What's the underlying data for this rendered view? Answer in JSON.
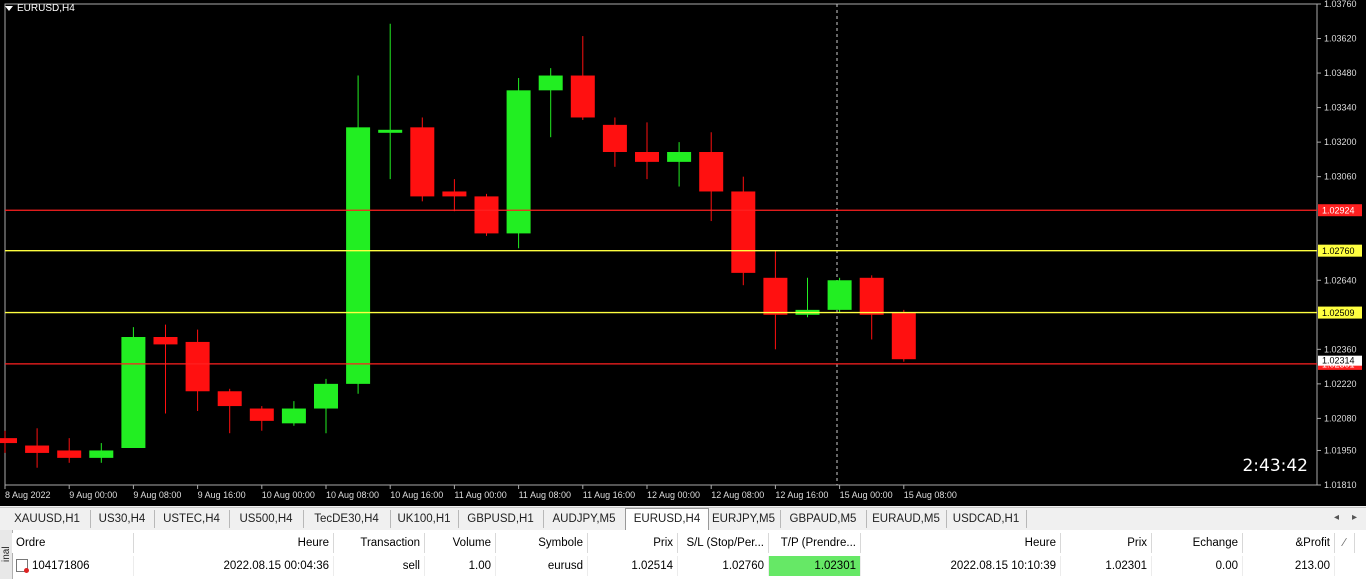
{
  "chart": {
    "title": "EURUSD,H4",
    "timer": "2:43:42"
  },
  "chart_data": {
    "type": "candlestick",
    "symbol": "EURUSD",
    "timeframe": "H4",
    "ylim": [
      1.0181,
      1.0376
    ],
    "price_ticks": [
      "1.03760",
      "1.03620",
      "1.03480",
      "1.03340",
      "1.03200",
      "1.03060",
      "1.02640",
      "1.02360",
      "1.02220",
      "1.02080",
      "1.01950",
      "1.01810"
    ],
    "time_labels": [
      "8 Aug 2022",
      "9 Aug 00:00",
      "9 Aug 08:00",
      "9 Aug 16:00",
      "10 Aug 00:00",
      "10 Aug 08:00",
      "10 Aug 16:00",
      "11 Aug 00:00",
      "11 Aug 08:00",
      "11 Aug 16:00",
      "12 Aug 00:00",
      "12 Aug 08:00",
      "12 Aug 16:00",
      "15 Aug 00:00",
      "15 Aug 08:00"
    ],
    "candles": [
      {
        "o": 1.02,
        "h": 1.0203,
        "l": 1.0194,
        "c": 1.0198
      },
      {
        "o": 1.0197,
        "h": 1.0204,
        "l": 1.0188,
        "c": 1.0194
      },
      {
        "o": 1.0195,
        "h": 1.02,
        "l": 1.019,
        "c": 1.0192
      },
      {
        "o": 1.0192,
        "h": 1.0198,
        "l": 1.019,
        "c": 1.0195
      },
      {
        "o": 1.0196,
        "h": 1.0245,
        "l": 1.0196,
        "c": 1.0241
      },
      {
        "o": 1.0241,
        "h": 1.0246,
        "l": 1.021,
        "c": 1.0238
      },
      {
        "o": 1.0239,
        "h": 1.0244,
        "l": 1.0211,
        "c": 1.0219
      },
      {
        "o": 1.0219,
        "h": 1.022,
        "l": 1.0202,
        "c": 1.0213
      },
      {
        "o": 1.0212,
        "h": 1.0213,
        "l": 1.0203,
        "c": 1.0207
      },
      {
        "o": 1.0206,
        "h": 1.0215,
        "l": 1.0205,
        "c": 1.0212
      },
      {
        "o": 1.0212,
        "h": 1.0224,
        "l": 1.0202,
        "c": 1.0222
      },
      {
        "o": 1.0222,
        "h": 1.0347,
        "l": 1.0218,
        "c": 1.0326
      },
      {
        "o": 1.0325,
        "h": 1.0368,
        "l": 1.0305,
        "c": 1.0325
      },
      {
        "o": 1.0326,
        "h": 1.033,
        "l": 1.0296,
        "c": 1.0298
      },
      {
        "o": 1.03,
        "h": 1.0305,
        "l": 1.0292,
        "c": 1.0298
      },
      {
        "o": 1.0298,
        "h": 1.0299,
        "l": 1.0282,
        "c": 1.0283
      },
      {
        "o": 1.0283,
        "h": 1.0346,
        "l": 1.0277,
        "c": 1.0341
      },
      {
        "o": 1.0341,
        "h": 1.035,
        "l": 1.0322,
        "c": 1.0347
      },
      {
        "o": 1.0347,
        "h": 1.0363,
        "l": 1.0329,
        "c": 1.033
      },
      {
        "o": 1.0327,
        "h": 1.033,
        "l": 1.031,
        "c": 1.0316
      },
      {
        "o": 1.0316,
        "h": 1.0328,
        "l": 1.0305,
        "c": 1.0312
      },
      {
        "o": 1.0312,
        "h": 1.032,
        "l": 1.0302,
        "c": 1.0316
      },
      {
        "o": 1.0316,
        "h": 1.0324,
        "l": 1.0288,
        "c": 1.03
      },
      {
        "o": 1.03,
        "h": 1.0306,
        "l": 1.0262,
        "c": 1.0267
      },
      {
        "o": 1.0265,
        "h": 1.0276,
        "l": 1.0236,
        "c": 1.025
      },
      {
        "o": 1.025,
        "h": 1.0265,
        "l": 1.0249,
        "c": 1.0252
      },
      {
        "o": 1.0252,
        "h": 1.0265,
        "l": 1.0251,
        "c": 1.0264
      },
      {
        "o": 1.0265,
        "h": 1.0266,
        "l": 1.024,
        "c": 1.025
      },
      {
        "o": 1.0251,
        "h": 1.0252,
        "l": 1.0231,
        "c": 1.0232
      }
    ],
    "hlines": [
      {
        "price": 1.02924,
        "label": "1.02924",
        "color": "#ff2020"
      },
      {
        "price": 1.0276,
        "label": "1.02760",
        "color": "#ffff40"
      },
      {
        "price": 1.02509,
        "label": "1.02509",
        "color": "#ffff40"
      },
      {
        "price": 1.02301,
        "label": "1.02301",
        "color": "#ff2020"
      }
    ],
    "current_price_label": "1.02314",
    "bull_color": "#22ee22",
    "bear_color": "#ff1010"
  },
  "tabs": [
    "XAUUSD,H1",
    "US30,H4",
    "USTEC,H4",
    "US500,H4",
    "TecDE30,H4",
    "UK100,H1",
    "GBPUSD,H1",
    "AUDJPY,M5",
    "EURUSD,H4",
    "EURJPY,M5",
    "GBPAUD,M5",
    "EURAUD,M5",
    "USDCAD,H1"
  ],
  "active_tab": "EURUSD,H4",
  "terminal": {
    "side_label": "inal",
    "headers": [
      "Ordre",
      "Heure",
      "Transaction",
      "Volume",
      "Symbole",
      "Prix",
      "S/L (Stop/Per...",
      "T/P (Prendre...",
      "Heure",
      "Prix",
      "Echange",
      "&Profit"
    ],
    "row": [
      "104171806",
      "2022.08.15 00:04:36",
      "sell",
      "1.00",
      "eurusd",
      "1.02514",
      "1.02760",
      "1.02301",
      "2022.08.15 10:10:39",
      "1.02301",
      "0.00",
      "213.00"
    ]
  }
}
